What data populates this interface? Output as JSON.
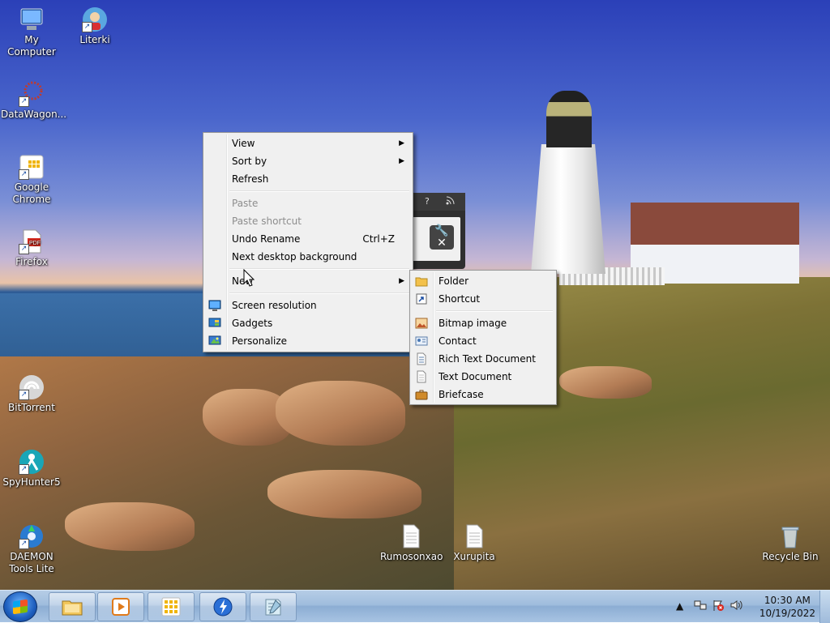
{
  "desktop": {
    "icons": [
      {
        "label": "My Computer"
      },
      {
        "label": "Literki"
      },
      {
        "label": "DataWagon..."
      },
      {
        "label": "Google Chrome"
      },
      {
        "label": "Firefox"
      },
      {
        "label": "BitTorrent"
      },
      {
        "label": "SpyHunter5"
      },
      {
        "label": "DAEMON Tools Lite"
      },
      {
        "label": "Rumosonxao"
      },
      {
        "label": "Xurupita"
      },
      {
        "label": "Recycle Bin"
      }
    ]
  },
  "context_menu": {
    "items": [
      {
        "label": "View",
        "submenu": true
      },
      {
        "label": "Sort by",
        "submenu": true
      },
      {
        "label": "Refresh"
      },
      {
        "label": "Paste",
        "disabled": true
      },
      {
        "label": "Paste shortcut",
        "disabled": true
      },
      {
        "label": "Undo Rename",
        "shortcut": "Ctrl+Z"
      },
      {
        "label": "Next desktop background"
      },
      {
        "label": "New",
        "submenu": true
      },
      {
        "label": "Screen resolution",
        "icon": "screen-resolution-icon"
      },
      {
        "label": "Gadgets",
        "icon": "gadgets-icon"
      },
      {
        "label": "Personalize",
        "icon": "personalize-icon"
      }
    ]
  },
  "new_submenu": {
    "items": [
      {
        "label": "Folder",
        "icon": "folder-icon"
      },
      {
        "label": "Shortcut",
        "icon": "shortcut-icon"
      },
      {
        "label": "Bitmap image",
        "icon": "bitmap-icon"
      },
      {
        "label": "Contact",
        "icon": "contact-icon"
      },
      {
        "label": "Rich Text Document",
        "icon": "rich-text-icon"
      },
      {
        "label": "Text Document",
        "icon": "text-document-icon"
      },
      {
        "label": "Briefcase",
        "icon": "briefcase-icon"
      }
    ]
  },
  "gadget_window": {
    "help_glyph": "?"
  },
  "taskbar": {
    "pinned": [
      "file-explorer-icon",
      "media-player-icon",
      "app-grid-icon",
      "dap-lightning-icon",
      "notepad-icon"
    ],
    "tray": {
      "time": "10:30 AM",
      "date": "10/19/2022"
    }
  }
}
